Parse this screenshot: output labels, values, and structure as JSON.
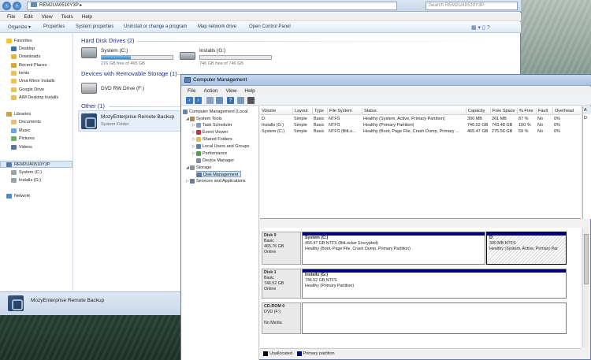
{
  "explorer": {
    "breadcrumb": "REM2UA0510Y3P  ▸",
    "search_placeholder": "Search REM2UA0510Y3P",
    "menu": [
      "File",
      "Edit",
      "View",
      "Tools",
      "Help"
    ],
    "commands": [
      "Organize ▾",
      "Properties",
      "System properties",
      "Uninstall or change a program",
      "Map network drive",
      "Open Control Panel"
    ],
    "nav": {
      "favorites": "Favorites",
      "favorite_items": [
        "Desktop",
        "Downloads",
        "Recent Places",
        "kents",
        "Ursa Minor Installs",
        "Google Drive",
        "AIM Desktop Installs"
      ],
      "libraries": "Libraries",
      "library_items": [
        "Documents",
        "Music",
        "Pictures",
        "Videos"
      ],
      "computer": "REM2UA0510Y3P",
      "computer_items": [
        "System (C:)",
        "Installs (G:)"
      ],
      "network": "Network"
    },
    "groups": {
      "hdd": "Hard Disk Drives (2)",
      "removable": "Devices with Removable Storage (1)",
      "other": "Other (1)"
    },
    "drives": {
      "c_name": "System (C:)",
      "c_free": "276 GB free of 465 GB",
      "c_used_pct": 41,
      "g_name": "Installs (G:)",
      "g_free": "746 GB free of 746 GB",
      "g_used_pct": 0,
      "dvd_name": "DVD RW Drive (F:)"
    },
    "other_item": {
      "name": "MozyEnterprise Remote Backup",
      "type": "System Folder"
    },
    "details_name": "MozyEnterprise Remote Backup"
  },
  "cm": {
    "title": "Computer Management",
    "menu": [
      "File",
      "Action",
      "View",
      "Help"
    ],
    "tree": {
      "root": "Computer Management (Local",
      "system_tools": "System Tools",
      "task_scheduler": "Task Scheduler",
      "event_viewer": "Event Viewer",
      "shared_folders": "Shared Folders",
      "local_users": "Local Users and Groups",
      "performance": "Performance",
      "device_manager": "Device Manager",
      "storage": "Storage",
      "disk_management": "Disk Management",
      "services": "Services and Applications"
    },
    "columns": [
      "Volume",
      "Layout",
      "Type",
      "File System",
      "Status",
      "Capacity",
      "Free Space",
      "% Free",
      "Fault",
      "Overhead"
    ],
    "volumes": [
      [
        "D:",
        "Simple",
        "Basic",
        "NTFS",
        "Healthy (System, Active, Primary Partition)",
        "300 MB",
        "261 MB",
        "87 %",
        "No",
        "0%"
      ],
      [
        "Installs (G:)",
        "Simple",
        "Basic",
        "NTFS",
        "Healthy (Primary Partition)",
        "746.52 GB",
        "743.48 GB",
        "100 %",
        "No",
        "0%"
      ],
      [
        "System (C:)",
        "Simple",
        "Basic",
        "NTFS (BitLo...",
        "Healthy (Boot, Page File, Crash Dump, Primary ...",
        "465.47 GB",
        "275.56 GB",
        "59 %",
        "No",
        "0%"
      ]
    ],
    "actions_letter": "A",
    "actions_item": "D",
    "disks": {
      "d0_name": "Disk 0",
      "d0_type": "Basic",
      "d0_size": "465.76 GB",
      "d0_state": "Online",
      "d0_p1_name": "System  (C:)",
      "d0_p1_fs": "465.47 GB NTFS (BitLocker Encrypted)",
      "d0_p1_status": "Healthy (Boot, Page File, Crash Dump, Primary Partition)",
      "d0_p2_name": "D:",
      "d0_p2_fs": "300 MB NTFS",
      "d0_p2_status": "Healthy (System, Active, Primary Par",
      "d1_name": "Disk 1",
      "d1_type": "Basic",
      "d1_size": "746.52 GB",
      "d1_state": "Online",
      "d1_p1_name": "Installs  (G:)",
      "d1_p1_fs": "746.52 GB NTFS",
      "d1_p1_status": "Healthy (Primary Partition)",
      "cd_name": "CD-ROM 0",
      "cd_drive": "DVD (F:)",
      "cd_media": "No Media"
    },
    "legend": {
      "unallocated": "Unallocated",
      "primary": "Primary partition"
    },
    "colors": {
      "primary": "#00007f",
      "unallocated": "#000000"
    }
  }
}
